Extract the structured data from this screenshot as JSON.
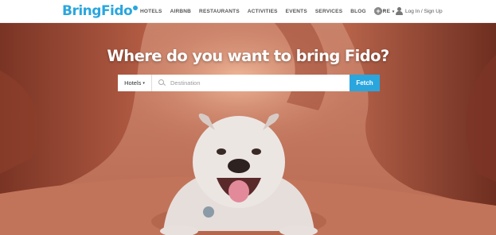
{
  "brand": {
    "logo_text": "BringFido",
    "color": "#2aa6de"
  },
  "nav": {
    "items": [
      {
        "label": "HOTELS"
      },
      {
        "label": "AIRBNB"
      },
      {
        "label": "RESTAURANTS"
      },
      {
        "label": "ACTIVITIES"
      },
      {
        "label": "EVENTS"
      },
      {
        "label": "SERVICES"
      },
      {
        "label": "BLOG"
      },
      {
        "label": "MORE"
      }
    ],
    "add_icon": "plus-circle-icon",
    "login_label": "Log In / Sign Up"
  },
  "hero": {
    "title": "Where do you want to bring Fido?",
    "search": {
      "type_selected": "Hotels",
      "placeholder": "Destination",
      "button_label": "Fetch"
    }
  }
}
